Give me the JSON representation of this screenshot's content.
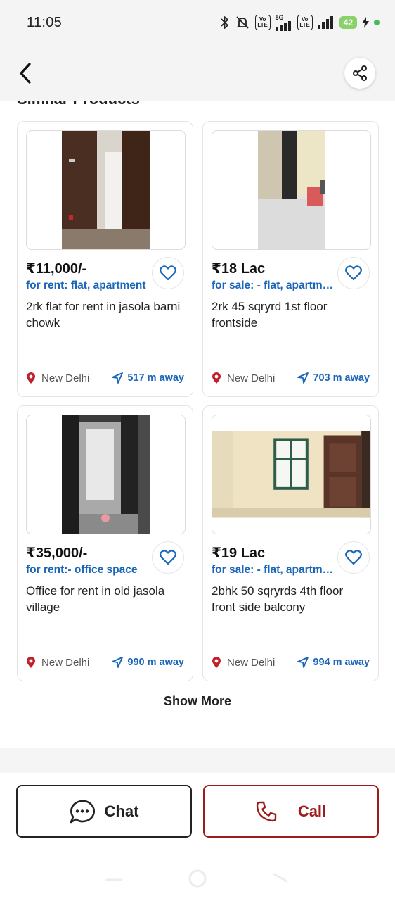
{
  "status_bar": {
    "time": "11:05",
    "network_5g": "5G",
    "volte_label": "Vo LTE",
    "battery": "42"
  },
  "header": {
    "back_icon": "back-arrow-icon",
    "share_icon": "share-icon"
  },
  "section": {
    "title": "Similar Products"
  },
  "products": [
    {
      "price": "₹11,000/-",
      "category": "for rent: flat, apartment",
      "title": "2rk flat for rent in jasola barni chowk",
      "location": "New Delhi",
      "distance": "517 m away"
    },
    {
      "price": "₹18 Lac",
      "category": "for sale: - flat, apartment",
      "title": "2rk 45 sqryrd 1st floor frontside",
      "location": "New Delhi",
      "distance": "703 m away"
    },
    {
      "price": "₹35,000/-",
      "category": "for rent:- office space",
      "title": "Office for rent in old jasola village",
      "location": "New Delhi",
      "distance": "990 m away"
    },
    {
      "price": "₹19 Lac",
      "category": "for sale: - flat, apartment",
      "title": "2bhk 50 sqryrds 4th floor front side balcony",
      "location": "New Delhi",
      "distance": "994 m away"
    }
  ],
  "show_more_label": "Show More",
  "actions": {
    "chat_label": "Chat",
    "call_label": "Call"
  },
  "colors": {
    "accent_blue": "#1a66b8",
    "call_red": "#9e1b1b",
    "location_pin_red": "#c0202a"
  }
}
